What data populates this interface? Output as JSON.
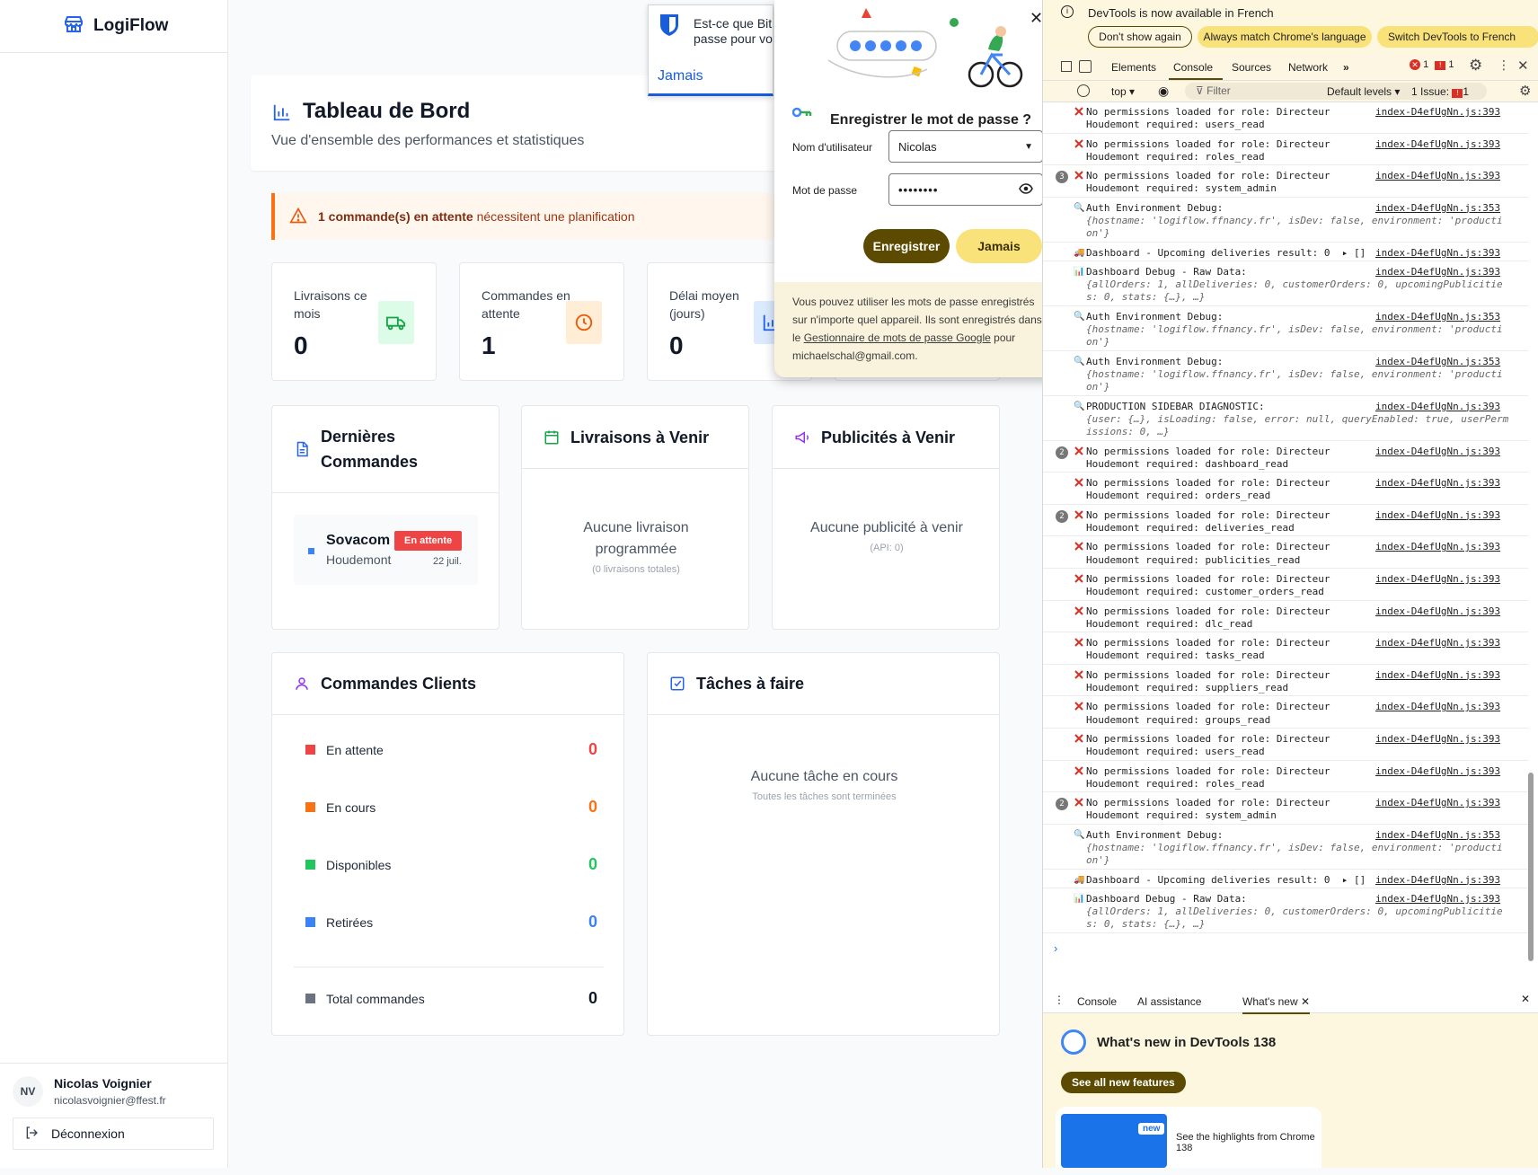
{
  "app": {
    "name": "LogiFlow"
  },
  "sidebar": {
    "user_initials": "NV",
    "user_name": "Nicolas Voignier",
    "user_email": "nicolasvoignier@ffest.fr",
    "logout_label": "Déconnexion"
  },
  "header": {
    "title": "Tableau de Bord",
    "subtitle": "Vue d'ensemble des performances et statistiques"
  },
  "alert": {
    "bold": "1 commande(s) en attente",
    "rest": " nécessitent une planification"
  },
  "stats": [
    {
      "label": "Livraisons ce mois",
      "value": "0"
    },
    {
      "label": "Commandes en attente",
      "value": "1"
    },
    {
      "label": "Délai moyen (jours)",
      "value": "0"
    }
  ],
  "recent_orders": {
    "title": "Dernières Commandes",
    "items": [
      {
        "name": "Sovacom",
        "status": "En attente",
        "location": "Houdemont",
        "date": "22 juil."
      }
    ]
  },
  "upcoming_deliveries": {
    "title": "Livraisons à Venir",
    "empty": "Aucune livraison programmée",
    "sub": "(0 livraisons totales)"
  },
  "upcoming_ads": {
    "title": "Publicités à Venir",
    "empty": "Aucune publicité à venir",
    "sub": "(API: 0)"
  },
  "customer_orders": {
    "title": "Commandes Clients",
    "rows": [
      {
        "label": "En attente",
        "value": "0",
        "color": "#ef4444"
      },
      {
        "label": "En cours",
        "value": "0",
        "color": "#f97316"
      },
      {
        "label": "Disponibles",
        "value": "0",
        "color": "#22c55e"
      },
      {
        "label": "Retirées",
        "value": "0",
        "color": "#3b82f6"
      }
    ],
    "total_label": "Total commandes",
    "total_value": "0"
  },
  "tasks": {
    "title": "Tâches à faire",
    "empty": "Aucune tâche en cours",
    "sub": "Toutes les tâches sont terminées"
  },
  "bitwarden": {
    "text_line1": "Est-ce que Bit",
    "text_line2": "passe pour vo",
    "never": "Jamais"
  },
  "password_prompt": {
    "title": "Enregistrer le mot de passe ?",
    "username_label": "Nom d'utilisateur",
    "username_value": "Nicolas",
    "password_label": "Mot de passe",
    "password_value": "••••••••",
    "save_button": "Enregistrer",
    "never_button": "Jamais",
    "footer_1": "Vous pouvez utiliser les mots de passe enregistrés sur n'importe quel appareil. Ils sont enregistrés dans le ",
    "footer_link": "Gestionnaire de mots de passe Google",
    "footer_2": " pour",
    "footer_email": "michaelschal@gmail.com."
  },
  "devtools": {
    "banner": "DevTools is now available in French",
    "btn_dont_show": "Don't show again",
    "btn_match": "Always match Chrome's language",
    "btn_switch": "Switch DevTools to French",
    "tabs": [
      "Elements",
      "Console",
      "Sources",
      "Network"
    ],
    "errors": "1",
    "warnings": "1",
    "context": "top",
    "filter_placeholder": "Filter",
    "levels": "Default levels",
    "issues": "1 Issue:",
    "issues_count": "1",
    "messages": [
      {
        "type": "error",
        "count": "",
        "text": "No permissions loaded for role: Directeur\nHoudemont required: users_read",
        "link": "index-D4efUgNn.js:393"
      },
      {
        "type": "error",
        "count": "",
        "text": "No permissions loaded for role: Directeur\nHoudemont required: roles_read",
        "link": "index-D4efUgNn.js:393"
      },
      {
        "type": "error",
        "count": "3",
        "text": "No permissions loaded for role: Directeur\nHoudemont required: system_admin",
        "link": "index-D4efUgNn.js:393"
      },
      {
        "type": "info",
        "count": "",
        "text": "Auth Environment Debug:",
        "sub": "{hostname: 'logiflow.ffnancy.fr', isDev: false, environment: 'producti\non'}",
        "link": "index-D4efUgNn.js:353"
      },
      {
        "type": "truck",
        "count": "",
        "text": "Dashboard - Upcoming deliveries result: 0  ▸ []",
        "link": "index-D4efUgNn.js:393"
      },
      {
        "type": "chart",
        "count": "",
        "text": "Dashboard Debug - Raw Data:",
        "sub": "{allOrders: 1, allDeliveries: 0, customerOrders: 0, upcomingPublicitie\ns: 0, stats: {…}, …}",
        "link": "index-D4efUgNn.js:393"
      },
      {
        "type": "info",
        "count": "",
        "text": "Auth Environment Debug:",
        "sub": "{hostname: 'logiflow.ffnancy.fr', isDev: false, environment: 'producti\non'}",
        "link": "index-D4efUgNn.js:353"
      },
      {
        "type": "info",
        "count": "",
        "text": "Auth Environment Debug:",
        "sub": "{hostname: 'logiflow.ffnancy.fr', isDev: false, environment: 'producti\non'}",
        "link": "index-D4efUgNn.js:353"
      },
      {
        "type": "info",
        "count": "",
        "text": "PRODUCTION SIDEBAR DIAGNOSTIC:",
        "sub": "{user: {…}, isLoading: false, error: null, queryEnabled: true, userPerm\nissions: 0, …}",
        "link": "index-D4efUgNn.js:393"
      },
      {
        "type": "error",
        "count": "2",
        "text": "No permissions loaded for role: Directeur\nHoudemont required: dashboard_read",
        "link": "index-D4efUgNn.js:393"
      },
      {
        "type": "error",
        "count": "",
        "text": "No permissions loaded for role: Directeur\nHoudemont required: orders_read",
        "link": "index-D4efUgNn.js:393"
      },
      {
        "type": "error",
        "count": "2",
        "text": "No permissions loaded for role: Directeur\nHoudemont required: deliveries_read",
        "link": "index-D4efUgNn.js:393"
      },
      {
        "type": "error",
        "count": "",
        "text": "No permissions loaded for role: Directeur\nHoudemont required: publicities_read",
        "link": "index-D4efUgNn.js:393"
      },
      {
        "type": "error",
        "count": "",
        "text": "No permissions loaded for role: Directeur\nHoudemont required: customer_orders_read",
        "link": "index-D4efUgNn.js:393"
      },
      {
        "type": "error",
        "count": "",
        "text": "No permissions loaded for role: Directeur\nHoudemont required: dlc_read",
        "link": "index-D4efUgNn.js:393"
      },
      {
        "type": "error",
        "count": "",
        "text": "No permissions loaded for role: Directeur\nHoudemont required: tasks_read",
        "link": "index-D4efUgNn.js:393"
      },
      {
        "type": "error",
        "count": "",
        "text": "No permissions loaded for role: Directeur\nHoudemont required: suppliers_read",
        "link": "index-D4efUgNn.js:393"
      },
      {
        "type": "error",
        "count": "",
        "text": "No permissions loaded for role: Directeur\nHoudemont required: groups_read",
        "link": "index-D4efUgNn.js:393"
      },
      {
        "type": "error",
        "count": "",
        "text": "No permissions loaded for role: Directeur\nHoudemont required: users_read",
        "link": "index-D4efUgNn.js:393"
      },
      {
        "type": "error",
        "count": "",
        "text": "No permissions loaded for role: Directeur\nHoudemont required: roles_read",
        "link": "index-D4efUgNn.js:393"
      },
      {
        "type": "error",
        "count": "2",
        "text": "No permissions loaded for role: Directeur\nHoudemont required: system_admin",
        "link": "index-D4efUgNn.js:393"
      },
      {
        "type": "info",
        "count": "",
        "text": "Auth Environment Debug:",
        "sub": "{hostname: 'logiflow.ffnancy.fr', isDev: false, environment: 'producti\non'}",
        "link": "index-D4efUgNn.js:353"
      },
      {
        "type": "truck",
        "count": "",
        "text": "Dashboard - Upcoming deliveries result: 0  ▸ []",
        "link": "index-D4efUgNn.js:393"
      },
      {
        "type": "chart",
        "count": "",
        "text": "Dashboard Debug - Raw Data:",
        "sub": "{allOrders: 1, allDeliveries: 0, customerOrders: 0, upcomingPublicitie\ns: 0, stats: {…}, …}",
        "link": "index-D4efUgNn.js:393"
      }
    ],
    "prompt": "›",
    "drawer_tabs": [
      "Console",
      "AI assistance",
      "What's new"
    ],
    "whats_new_title": "What's new in DevTools 138",
    "see_all": "See all new features",
    "new_badge": "new",
    "highlights": "See the highlights from Chrome 138"
  }
}
